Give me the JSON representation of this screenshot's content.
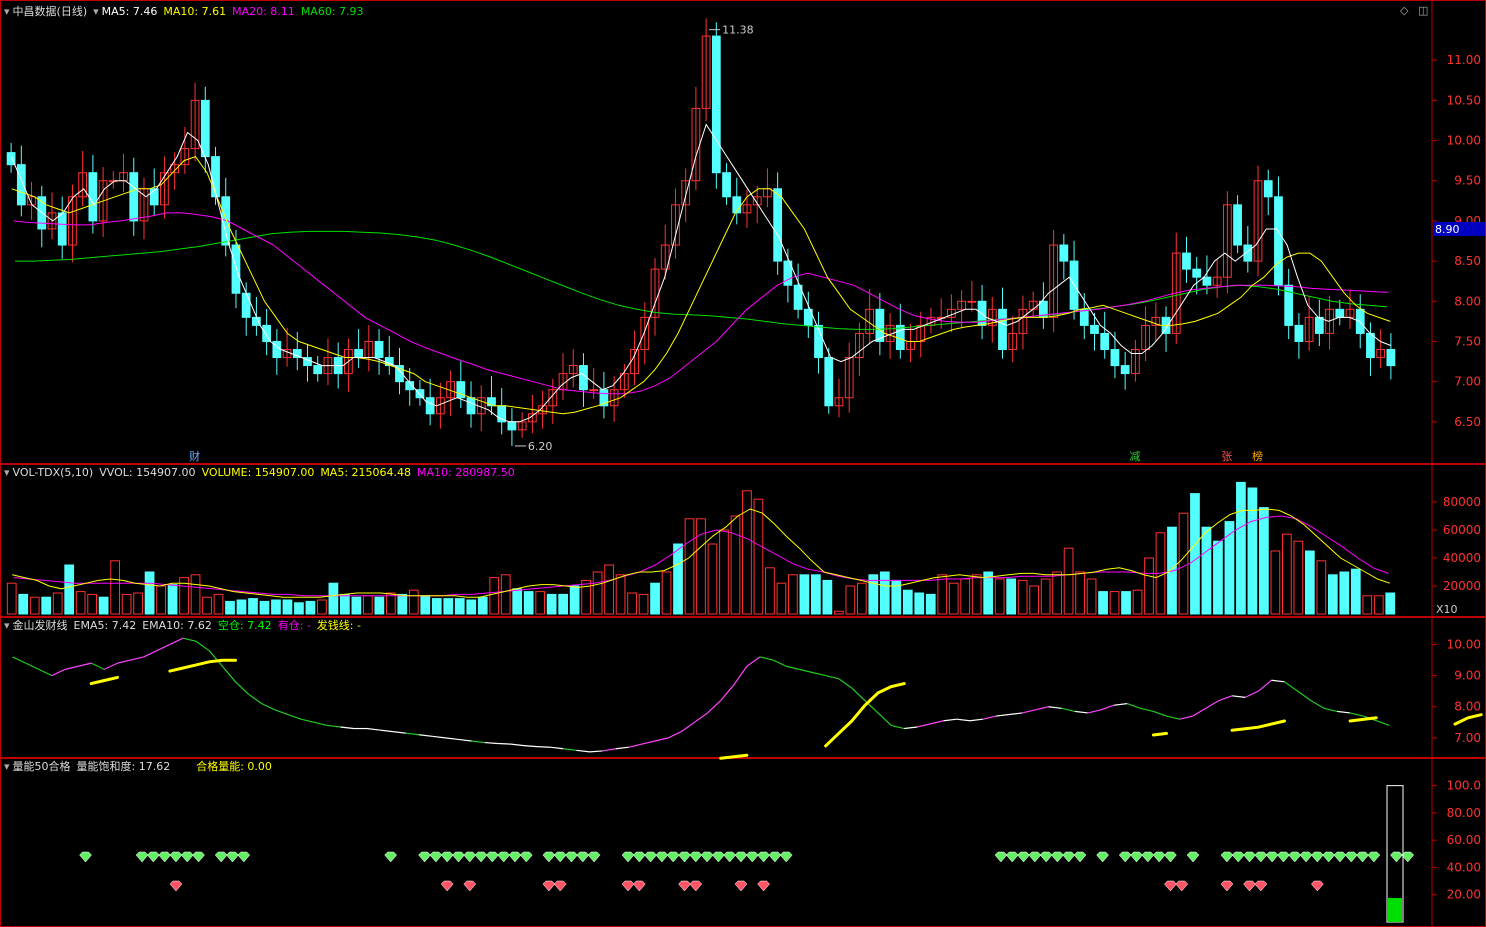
{
  "header": {
    "title": "中昌数据(日线)",
    "ma5": "MA5: 7.46",
    "ma10": "MA10: 7.61",
    "ma20": "MA20: 8.11",
    "ma60": "MA60: 7.93"
  },
  "vol_header": {
    "title": "VOL-TDX(5,10)",
    "vvol": "VVOL: 154907.00",
    "volume": "VOLUME: 154907.00",
    "ma5": "MA5: 215064.48",
    "ma10": "MA10: 280987.50"
  },
  "gold_header": {
    "title": "金山发财线",
    "ema5": "EMA5: 7.42",
    "ema10": "EMA10: 7.62",
    "kongcang": "空仓: 7.42",
    "youcang": "有仓: -",
    "faqian": "发钱线: -"
  },
  "energy_header": {
    "title": "量能50合格",
    "saturation": "量能饱和度: 17.62",
    "qualified": "合格量能: 0.00"
  },
  "colors": {
    "up": "#ff3232",
    "down": "#54ffff",
    "ma5": "#ffffff",
    "ma10": "#ffff00",
    "ma20": "#ff00ff",
    "ma60": "#00e000",
    "axis": "#c00000"
  },
  "chart_data": [
    {
      "type": "candlestick",
      "title": "中昌数据(日线)",
      "y_ticks": [
        "11.00",
        "10.50",
        "10.00",
        "9.50",
        "9.00",
        "8.50",
        "8.00",
        "7.50",
        "7.00",
        "6.50"
      ],
      "ylim": [
        6.05,
        11.5
      ],
      "high_label": "11.38",
      "low_label": "6.20",
      "current_price": "8.90",
      "markers": [
        "财",
        "减",
        "张",
        "榜"
      ],
      "closes": [
        9.7,
        9.2,
        9.3,
        8.9,
        9.1,
        8.7,
        9.3,
        9.6,
        9.0,
        9.5,
        9.5,
        9.6,
        9.0,
        9.4,
        9.2,
        9.6,
        9.7,
        9.9,
        10.5,
        9.8,
        9.3,
        8.7,
        8.1,
        7.8,
        7.7,
        7.5,
        7.3,
        7.4,
        7.3,
        7.2,
        7.1,
        7.3,
        7.1,
        7.4,
        7.3,
        7.5,
        7.3,
        7.2,
        7.0,
        6.9,
        6.8,
        6.6,
        6.8,
        7.0,
        6.8,
        6.6,
        6.8,
        6.7,
        6.5,
        6.4,
        6.5,
        6.6,
        6.7,
        6.9,
        7.1,
        7.2,
        6.9,
        6.9,
        6.7,
        6.9,
        7.1,
        7.4,
        7.8,
        8.4,
        8.7,
        9.2,
        9.5,
        10.4,
        11.3,
        9.6,
        9.3,
        9.1,
        9.2,
        9.3,
        9.4,
        8.5,
        8.2,
        7.9,
        7.7,
        7.3,
        6.7,
        6.8,
        7.3,
        7.6,
        7.9,
        7.5,
        7.7,
        7.4,
        7.5,
        7.7,
        7.8,
        7.8,
        7.9,
        8.0,
        8.0,
        7.7,
        7.9,
        7.4,
        7.6,
        7.9,
        8.0,
        7.8,
        8.7,
        8.5,
        7.9,
        7.7,
        7.6,
        7.4,
        7.2,
        7.1,
        7.4,
        7.7,
        7.8,
        7.6,
        8.6,
        8.4,
        8.3,
        8.2,
        8.3,
        9.2,
        8.7,
        8.5,
        9.5,
        9.3,
        8.2,
        7.7,
        7.5,
        7.8,
        7.6,
        7.9,
        7.8,
        7.9,
        7.6,
        7.3,
        7.4,
        7.2
      ],
      "ma5": [
        9.8,
        9.5,
        9.2,
        9.1,
        9.0,
        9.1,
        9.3,
        9.4,
        9.2,
        9.4,
        9.5,
        9.5,
        9.4,
        9.3,
        9.4,
        9.6,
        9.8,
        10.1,
        10.0,
        9.7,
        9.2,
        8.7,
        8.3,
        8.0,
        7.7,
        7.5,
        7.4,
        7.35,
        7.3,
        7.25,
        7.2,
        7.2,
        7.2,
        7.3,
        7.3,
        7.3,
        7.25,
        7.2,
        7.05,
        6.9,
        6.75,
        6.7,
        6.75,
        6.8,
        6.75,
        6.7,
        6.65,
        6.55,
        6.5,
        6.5,
        6.55,
        6.65,
        6.8,
        6.95,
        7.05,
        7.1,
        7.0,
        6.9,
        6.95,
        7.1,
        7.3,
        7.6,
        7.95,
        8.3,
        8.8,
        9.3,
        9.8,
        10.2,
        10.0,
        9.8,
        9.6,
        9.4,
        9.2,
        9.0,
        8.8,
        8.5,
        8.2,
        7.9,
        7.6,
        7.3,
        7.25,
        7.3,
        7.4,
        7.5,
        7.55,
        7.6,
        7.65,
        7.65,
        7.7,
        7.75,
        7.8,
        7.85,
        7.9,
        7.9,
        7.8,
        7.75,
        7.7,
        7.75,
        7.85,
        7.95,
        8.1,
        8.2,
        8.3,
        8.1,
        7.9,
        7.7,
        7.6,
        7.45,
        7.35,
        7.35,
        7.45,
        7.6,
        7.8,
        8.0,
        8.2,
        8.3,
        8.5,
        8.6,
        8.5,
        8.6,
        8.7,
        8.9,
        8.9,
        8.7,
        8.3,
        7.95,
        7.8,
        7.75,
        7.8,
        7.8,
        7.75,
        7.6,
        7.5,
        7.45
      ],
      "ma10": [
        9.4,
        9.35,
        9.3,
        9.2,
        9.15,
        9.1,
        9.15,
        9.2,
        9.25,
        9.3,
        9.35,
        9.4,
        9.4,
        9.45,
        9.6,
        9.75,
        9.8,
        9.6,
        9.25,
        8.9,
        8.6,
        8.3,
        8.0,
        7.8,
        7.6,
        7.5,
        7.45,
        7.4,
        7.35,
        7.3,
        7.3,
        7.28,
        7.25,
        7.2,
        7.15,
        7.1,
        7.0,
        6.95,
        6.9,
        6.85,
        6.8,
        6.75,
        6.7,
        6.7,
        6.68,
        6.66,
        6.64,
        6.62,
        6.6,
        6.62,
        6.66,
        6.7,
        6.75,
        6.8,
        6.9,
        7.0,
        7.15,
        7.35,
        7.6,
        7.9,
        8.2,
        8.5,
        8.8,
        9.1,
        9.3,
        9.4,
        9.4,
        9.3,
        9.1,
        8.9,
        8.6,
        8.3,
        8.1,
        7.9,
        7.8,
        7.7,
        7.6,
        7.55,
        7.5,
        7.5,
        7.55,
        7.6,
        7.65,
        7.68,
        7.7,
        7.72,
        7.75,
        7.78,
        7.8,
        7.8,
        7.8,
        7.82,
        7.85,
        7.9,
        7.92,
        7.95,
        7.9,
        7.85,
        7.8,
        7.75,
        7.7,
        7.7,
        7.72,
        7.75,
        7.8,
        7.85,
        7.95,
        8.05,
        8.2,
        8.3,
        8.45,
        8.55,
        8.6,
        8.6,
        8.5,
        8.3,
        8.1,
        7.95,
        7.85,
        7.8,
        7.75
      ],
      "ma20": [
        9.0,
        8.98,
        8.97,
        8.96,
        8.95,
        8.95,
        8.98,
        9.0,
        9.03,
        9.06,
        9.1,
        9.1,
        9.08,
        9.05,
        9.0,
        8.9,
        8.8,
        8.7,
        8.55,
        8.4,
        8.25,
        8.1,
        7.95,
        7.8,
        7.7,
        7.6,
        7.5,
        7.42,
        7.35,
        7.28,
        7.22,
        7.15,
        7.1,
        7.05,
        7.0,
        6.95,
        6.9,
        6.88,
        6.86,
        6.85,
        6.85,
        6.88,
        6.95,
        7.05,
        7.2,
        7.35,
        7.5,
        7.7,
        7.9,
        8.05,
        8.2,
        8.3,
        8.35,
        8.3,
        8.25,
        8.2,
        8.1,
        8.0,
        7.9,
        7.82,
        7.78,
        7.75,
        7.74,
        7.74,
        7.76,
        7.78,
        7.8,
        7.82,
        7.84,
        7.86,
        7.88,
        7.9,
        7.93,
        7.96,
        8.0,
        8.05,
        8.1,
        8.14,
        8.16,
        8.18,
        8.2,
        8.2,
        8.2,
        8.19,
        8.18,
        8.16,
        8.15,
        8.14,
        8.13,
        8.12,
        8.11
      ],
      "ma60": [
        8.5,
        8.5,
        8.51,
        8.52,
        8.54,
        8.56,
        8.58,
        8.6,
        8.62,
        8.65,
        8.68,
        8.72,
        8.76,
        8.8,
        8.84,
        8.86,
        8.87,
        8.87,
        8.87,
        8.86,
        8.85,
        8.83,
        8.8,
        8.76,
        8.7,
        8.63,
        8.55,
        8.46,
        8.37,
        8.28,
        8.19,
        8.1,
        8.02,
        7.95,
        7.9,
        7.86,
        7.84,
        7.83,
        7.82,
        7.8,
        7.78,
        7.75,
        7.72,
        7.7,
        7.68,
        7.66,
        7.65,
        7.65,
        7.66,
        7.68,
        7.7,
        7.72,
        7.74,
        7.76,
        7.78,
        7.8,
        7.82,
        7.84,
        7.87,
        7.9,
        7.93,
        7.96,
        8.0,
        8.05,
        8.1,
        8.15,
        8.18,
        8.2,
        8.18,
        8.15,
        8.1,
        8.05,
        8.0,
        7.97,
        7.95,
        7.93
      ]
    },
    {
      "type": "bar",
      "title": "VOL-TDX(5,10)",
      "y_ticks": [
        "80000",
        "60000",
        "40000",
        "20000"
      ],
      "ylim": [
        0,
        95000
      ],
      "unit_label": "X10",
      "values": [
        22000,
        14000,
        12000,
        12000,
        15000,
        35000,
        16000,
        14000,
        12000,
        38000,
        14000,
        15000,
        30000,
        20000,
        21000,
        26000,
        28000,
        12000,
        14000,
        9000,
        10000,
        11000,
        9000,
        10000,
        10000,
        8000,
        9000,
        10000,
        22000,
        14000,
        12000,
        13000,
        12000,
        15000,
        14000,
        17000,
        13000,
        11000,
        11000,
        11000,
        10000,
        12000,
        26000,
        28000,
        18000,
        16000,
        16000,
        14000,
        14000,
        20000,
        24000,
        30000,
        35000,
        28000,
        15000,
        14000,
        22000,
        30000,
        50000,
        68000,
        68000,
        50000,
        60000,
        70000,
        88000,
        82000,
        33000,
        22000,
        28000,
        28000,
        28000,
        24000,
        2000,
        20000,
        22000,
        28000,
        30000,
        24000,
        17000,
        15000,
        14000,
        28000,
        22000,
        25000,
        28000,
        30000,
        25000,
        25000,
        24000,
        20000,
        25000,
        30000,
        47000,
        30000,
        25000,
        16000,
        16000,
        16000,
        17000,
        40000,
        58000,
        62000,
        72000,
        86000,
        62000,
        52000,
        66000,
        94000,
        90000,
        76000,
        45000,
        57000,
        52000,
        45000,
        38000,
        28000,
        30000,
        32000,
        13000,
        13000,
        15000
      ],
      "ma5": [
        28000,
        26000,
        24000,
        20000,
        18000,
        20000,
        22000,
        24000,
        25000,
        24000,
        22000,
        21000,
        20000,
        22000,
        22000,
        21000,
        20000,
        18000,
        16000,
        15000,
        14000,
        13000,
        12000,
        12000,
        12000,
        12000,
        13000,
        14000,
        15000,
        15000,
        15000,
        14000,
        13000,
        13000,
        13000,
        13000,
        13000,
        12000,
        12000,
        14000,
        16000,
        18000,
        20000,
        21000,
        21000,
        20000,
        19000,
        20000,
        22000,
        25000,
        28000,
        30000,
        30000,
        31000,
        35000,
        40000,
        48000,
        56000,
        62000,
        70000,
        75000,
        72000,
        64000,
        55000,
        47000,
        38000,
        30000,
        28000,
        26000,
        24000,
        22000,
        20000,
        20000,
        22000,
        24000,
        26000,
        27000,
        28000,
        27000,
        26000,
        27000,
        28000,
        29000,
        29000,
        28000,
        28000,
        28000,
        29000,
        30000,
        32000,
        33000,
        31000,
        28000,
        26000,
        30000,
        38000,
        48000,
        58000,
        65000,
        71000,
        74000,
        74000,
        75000,
        74000,
        70000,
        64000,
        56000,
        48000,
        40000,
        35000,
        30000,
        25000,
        22000
      ],
      "ma10": [
        26000,
        25000,
        24000,
        23000,
        22000,
        22000,
        22000,
        22000,
        22000,
        22000,
        21000,
        20000,
        19000,
        18000,
        17000,
        16000,
        15000,
        14000,
        14000,
        13000,
        13000,
        13000,
        13000,
        13000,
        13000,
        13000,
        13000,
        13000,
        13000,
        14000,
        14000,
        15000,
        16000,
        17000,
        18000,
        19000,
        20000,
        21000,
        22000,
        24000,
        27000,
        30000,
        35000,
        42000,
        50000,
        57000,
        60000,
        58000,
        54000,
        48000,
        42000,
        36000,
        32000,
        30000,
        27000,
        25000,
        24000,
        24000,
        24000,
        24000,
        24000,
        25000,
        25000,
        26000,
        26000,
        26000,
        27000,
        27000,
        27000,
        28000,
        29000,
        30000,
        30000,
        30000,
        29000,
        29000,
        31000,
        36000,
        44000,
        52000,
        60000,
        66000,
        69000,
        70000,
        68000,
        62000,
        55000,
        48000,
        40000,
        33000,
        29000
      ]
    },
    {
      "type": "line",
      "title": "金山发财线",
      "y_ticks": [
        "10.00",
        "9.00",
        "8.00",
        "7.00"
      ],
      "ylim": [
        6.45,
        10.4
      ],
      "ema5": [
        9.6,
        9.4,
        9.2,
        9.0,
        9.2,
        9.3,
        9.4,
        9.2,
        9.4,
        9.5,
        9.6,
        9.8,
        10.0,
        10.2,
        10.1,
        9.8,
        9.3,
        8.8,
        8.4,
        8.1,
        7.9,
        7.75,
        7.6,
        7.5,
        7.4,
        7.35,
        7.3,
        7.3,
        7.25,
        7.2,
        7.15,
        7.1,
        7.05,
        7.0,
        6.95,
        6.9,
        6.85,
        6.82,
        6.8,
        6.75,
        6.72,
        6.7,
        6.65,
        6.6,
        6.55,
        6.58,
        6.65,
        6.7,
        6.8,
        6.9,
        7.0,
        7.2,
        7.5,
        7.8,
        8.2,
        8.7,
        9.3,
        9.6,
        9.5,
        9.3,
        9.2,
        9.1,
        9.0,
        8.9,
        8.6,
        8.2,
        7.8,
        7.4,
        7.3,
        7.35,
        7.45,
        7.55,
        7.6,
        7.55,
        7.6,
        7.7,
        7.75,
        7.8,
        7.9,
        8.0,
        7.95,
        7.85,
        7.8,
        7.9,
        8.05,
        8.1,
        7.95,
        7.85,
        7.7,
        7.6,
        7.7,
        7.95,
        8.2,
        8.35,
        8.3,
        8.5,
        8.85,
        8.8,
        8.5,
        8.2,
        7.95,
        7.85,
        7.8,
        7.7,
        7.55,
        7.4
      ],
      "ema10_segments": [
        [
          9.0,
          9.1,
          9.2
        ],
        [
          9.4,
          9.5,
          9.6,
          9.7,
          9.75,
          9.75
        ],
        [
          6.6,
          6.65,
          6.7
        ],
        [
          7.0,
          7.4,
          7.8,
          8.3,
          8.7,
          8.9,
          9.0
        ],
        [
          7.35,
          7.4
        ],
        [
          7.5,
          7.55,
          7.6,
          7.7,
          7.8
        ],
        [
          7.8,
          7.85,
          7.9
        ],
        [
          7.7,
          7.9,
          8.0
        ],
        [
          8.3,
          8.4,
          8.5,
          8.6
        ]
      ]
    },
    {
      "type": "scatter",
      "title": "量能50合格",
      "y_ticks": [
        "100.0",
        "80.00",
        "60.00",
        "40.00",
        "20.00"
      ],
      "ylim": [
        0,
        110
      ],
      "saturation": 17.62,
      "green_days": [
        3,
        8,
        9,
        10,
        11,
        12,
        13,
        15,
        16,
        17,
        30,
        33,
        34,
        35,
        36,
        37,
        38,
        39,
        40,
        41,
        42,
        44,
        45,
        46,
        47,
        48,
        51,
        52,
        53,
        54,
        55,
        56,
        57,
        58,
        59,
        60,
        61,
        62,
        63,
        64,
        65,
        84,
        85,
        86,
        87,
        88,
        89,
        90,
        91,
        93,
        95,
        96,
        97,
        98,
        99,
        101,
        104,
        105,
        106,
        107,
        108,
        109,
        110,
        111,
        112,
        113,
        114,
        115,
        116,
        117,
        119,
        120
      ],
      "red_days": [
        11,
        35,
        37,
        44,
        45,
        51,
        52,
        56,
        57,
        61,
        63,
        99,
        100,
        104,
        106,
        107,
        112
      ]
    }
  ]
}
